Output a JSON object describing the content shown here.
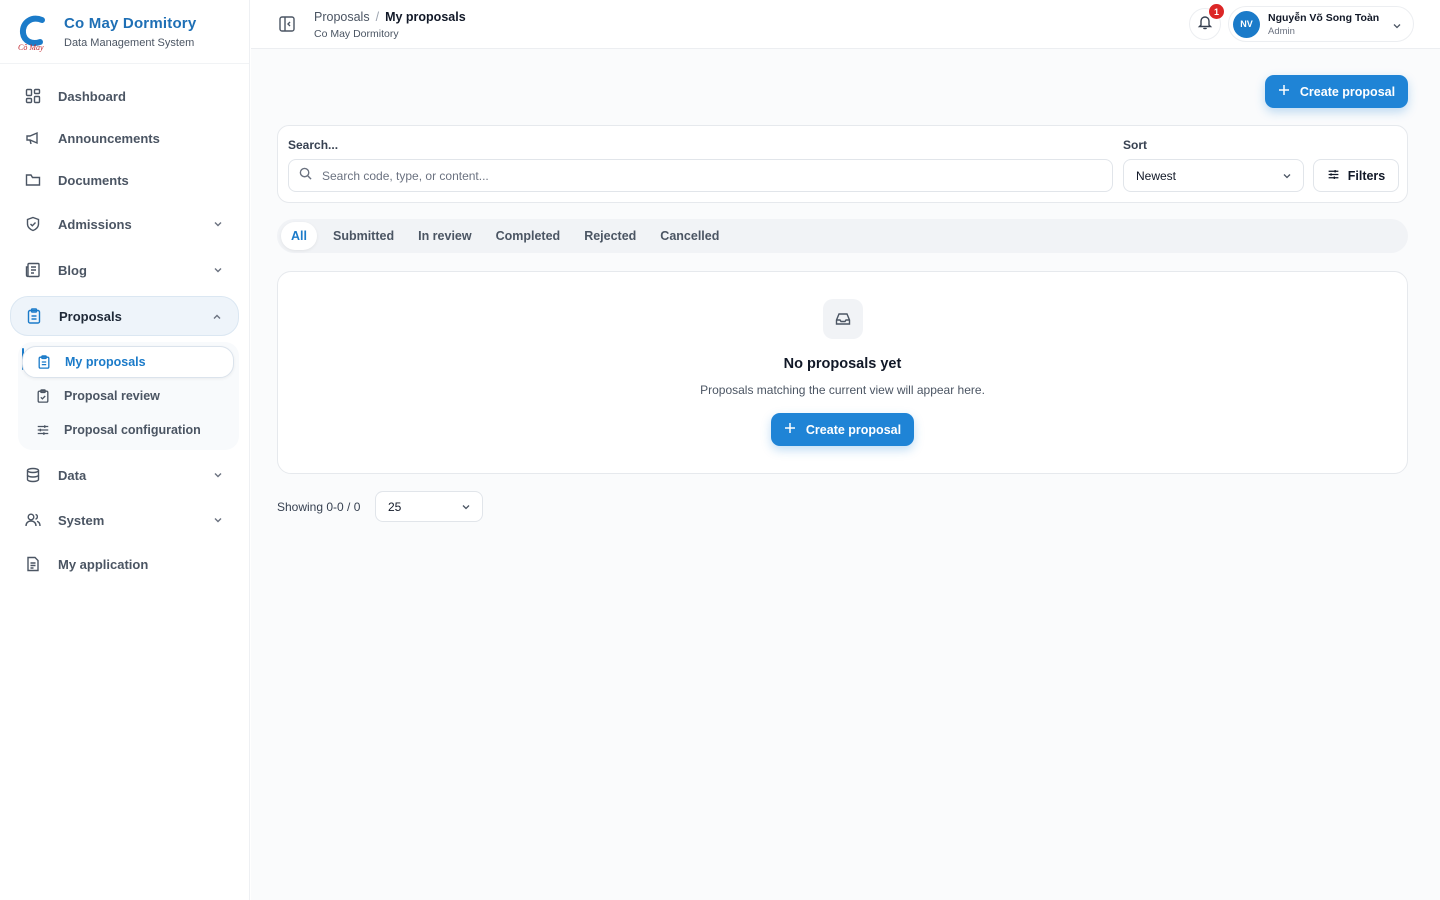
{
  "brand": {
    "name": "Co May Dormitory",
    "subtitle": "Data Management System"
  },
  "sidebar": {
    "items": [
      {
        "label": "Dashboard",
        "icon": "grid-icon"
      },
      {
        "label": "Announcements",
        "icon": "megaphone-icon"
      },
      {
        "label": "Documents",
        "icon": "folder-icon"
      },
      {
        "label": "Admissions",
        "icon": "shield-icon"
      },
      {
        "label": "Blog",
        "icon": "newspaper-icon"
      },
      {
        "label": "Proposals",
        "icon": "clipboard-icon"
      },
      {
        "label": "Data",
        "icon": "database-icon"
      },
      {
        "label": "System",
        "icon": "users-icon"
      },
      {
        "label": "My application",
        "icon": "file-icon"
      }
    ],
    "proposals_sub": [
      {
        "label": "My proposals",
        "icon": "clipboard-icon"
      },
      {
        "label": "Proposal review",
        "icon": "clipboard-check-icon"
      },
      {
        "label": "Proposal configuration",
        "icon": "sliders-icon"
      }
    ]
  },
  "header": {
    "crumb_parent": "Proposals",
    "crumb_sep": "/",
    "crumb_current": "My proposals",
    "crumb_sub": "Co May Dormitory",
    "notifications": "1",
    "user": {
      "initials": "NV",
      "name": "Nguyễn Võ Song Toàn",
      "role": "Admin"
    }
  },
  "toolbar": {
    "create_label": "Create proposal"
  },
  "search": {
    "label": "Search...",
    "placeholder": "Search code, type, or content...",
    "sort_label": "Sort",
    "sort_value": "Newest",
    "filters_label": "Filters"
  },
  "tabs": [
    "All",
    "Submitted",
    "In review",
    "Completed",
    "Rejected",
    "Cancelled"
  ],
  "empty": {
    "title": "No proposals yet",
    "description": "Proposals matching the current view will appear here.",
    "button_label": "Create proposal"
  },
  "pagination": {
    "showing": "Showing 0-0 / 0",
    "page_size": "25"
  },
  "colors": {
    "accent": "#1f84d6",
    "brand": "#1e6fb5",
    "badge": "#dc2626"
  }
}
